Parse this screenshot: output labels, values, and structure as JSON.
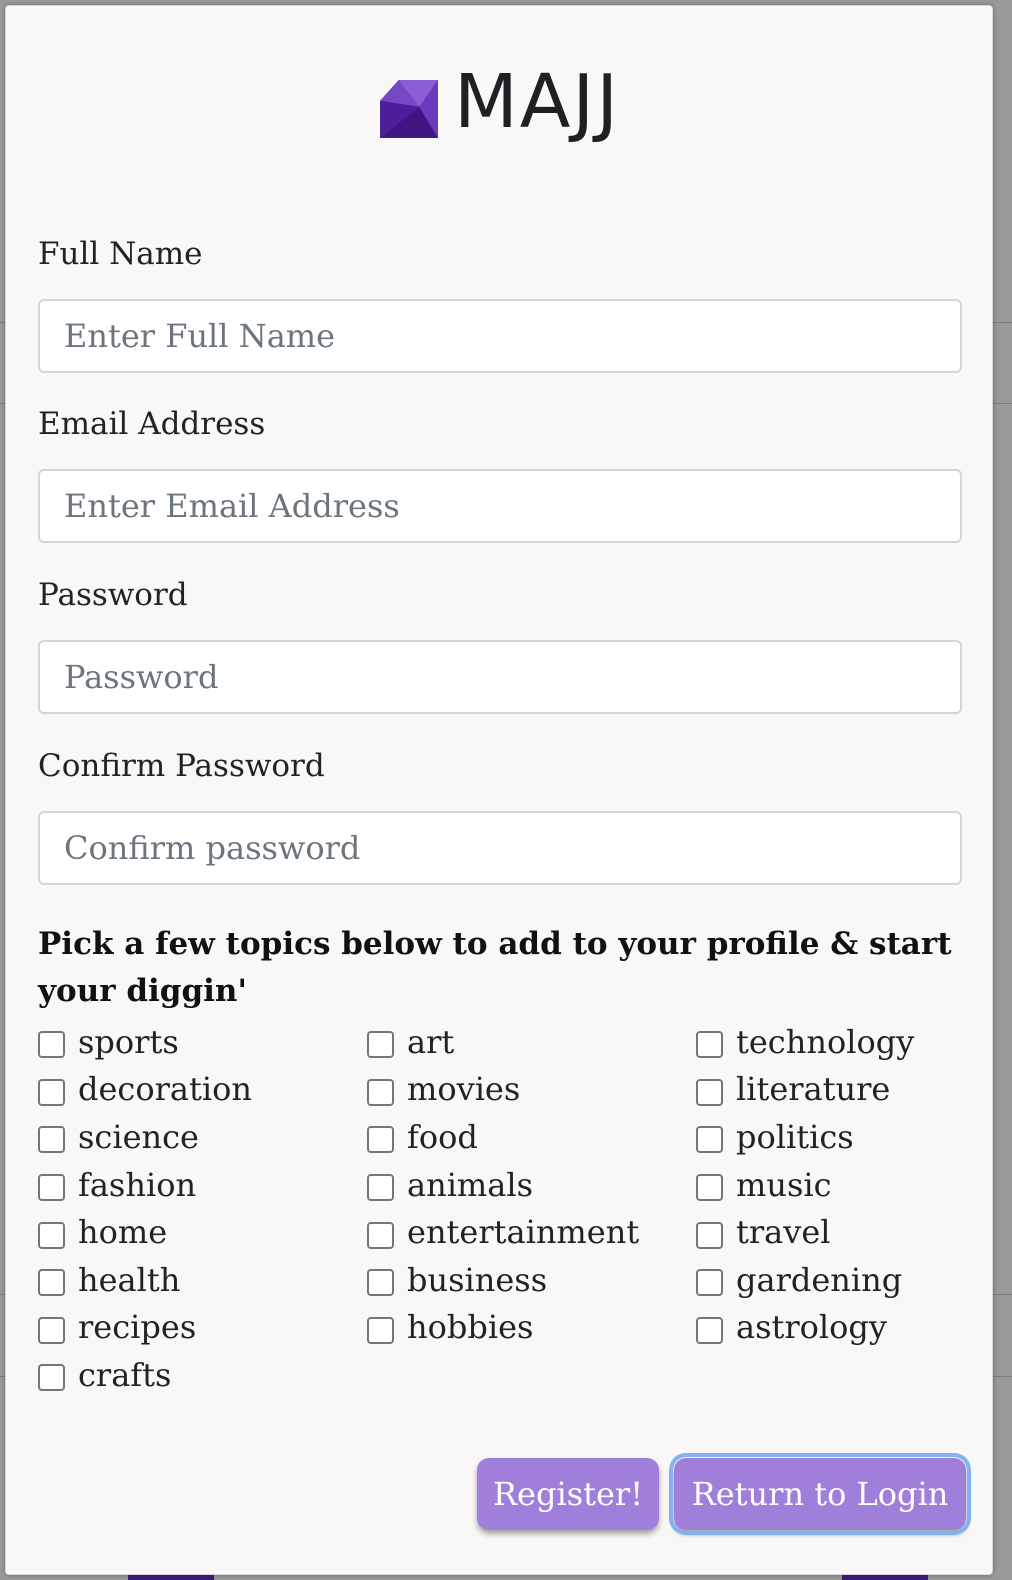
{
  "brand": {
    "name": "MAJJ",
    "logo_icon": "gem-icon",
    "accent": "#5b2bb0"
  },
  "form": {
    "full_name": {
      "label": "Full Name",
      "placeholder": "Enter Full Name"
    },
    "email": {
      "label": "Email Address",
      "placeholder": "Enter Email Address"
    },
    "password": {
      "label": "Password",
      "placeholder": "Password"
    },
    "confirm_password": {
      "label": "Confirm Password",
      "placeholder": "Confirm password"
    }
  },
  "topics": {
    "heading": "Pick a few topics below to add to your profile & start your diggin'",
    "items": [
      "sports",
      "art",
      "technology",
      "decoration",
      "movies",
      "literature",
      "science",
      "food",
      "politics",
      "fashion",
      "animals",
      "music",
      "home",
      "entertainment",
      "travel",
      "health",
      "business",
      "gardening",
      "recipes",
      "hobbies",
      "astrology",
      "crafts"
    ]
  },
  "buttons": {
    "register": "Register!",
    "return_login": "Return to Login",
    "color": "#a07fdb"
  }
}
